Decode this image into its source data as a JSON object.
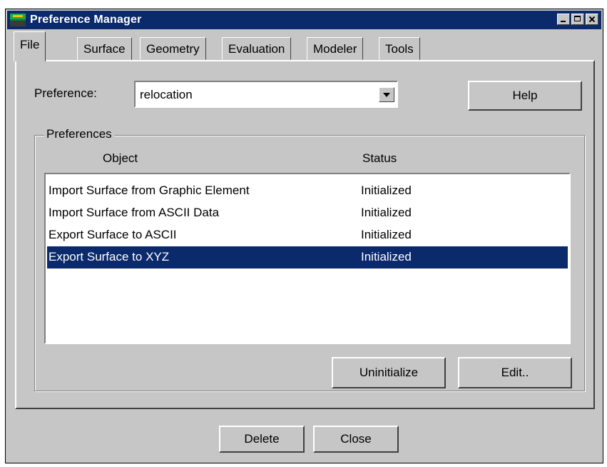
{
  "window": {
    "title": "Preference Manager",
    "controls": [
      "minimize-icon",
      "maximize-icon",
      "close-icon"
    ]
  },
  "tabs": [
    {
      "label": "File",
      "active": true
    },
    {
      "label": "Surface",
      "active": false
    },
    {
      "label": "Geometry",
      "active": false
    },
    {
      "label": "Evaluation",
      "active": false
    },
    {
      "label": "Modeler",
      "active": false
    },
    {
      "label": "Tools",
      "active": false
    }
  ],
  "preference": {
    "label": "Preference:",
    "value": "relocation"
  },
  "help_button": "Help",
  "preferences_group": {
    "legend": "Preferences",
    "columns": {
      "object": "Object",
      "status": "Status"
    },
    "rows": [
      {
        "object": "Import Surface from Graphic Element",
        "status": "Initialized",
        "selected": false
      },
      {
        "object": "Import Surface from ASCII Data",
        "status": "Initialized",
        "selected": false
      },
      {
        "object": "Export Surface to ASCII",
        "status": "Initialized",
        "selected": false
      },
      {
        "object": "Export Surface to  XYZ",
        "status": "Initialized",
        "selected": true
      }
    ],
    "uninitialize_button": "Uninitialize",
    "edit_button": "Edit.."
  },
  "footer": {
    "delete_button": "Delete",
    "close_button": "Close"
  },
  "colors": {
    "titlebar": "#0a2a6c",
    "selection": "#0a2a6c",
    "face": "#c6c6c6"
  }
}
